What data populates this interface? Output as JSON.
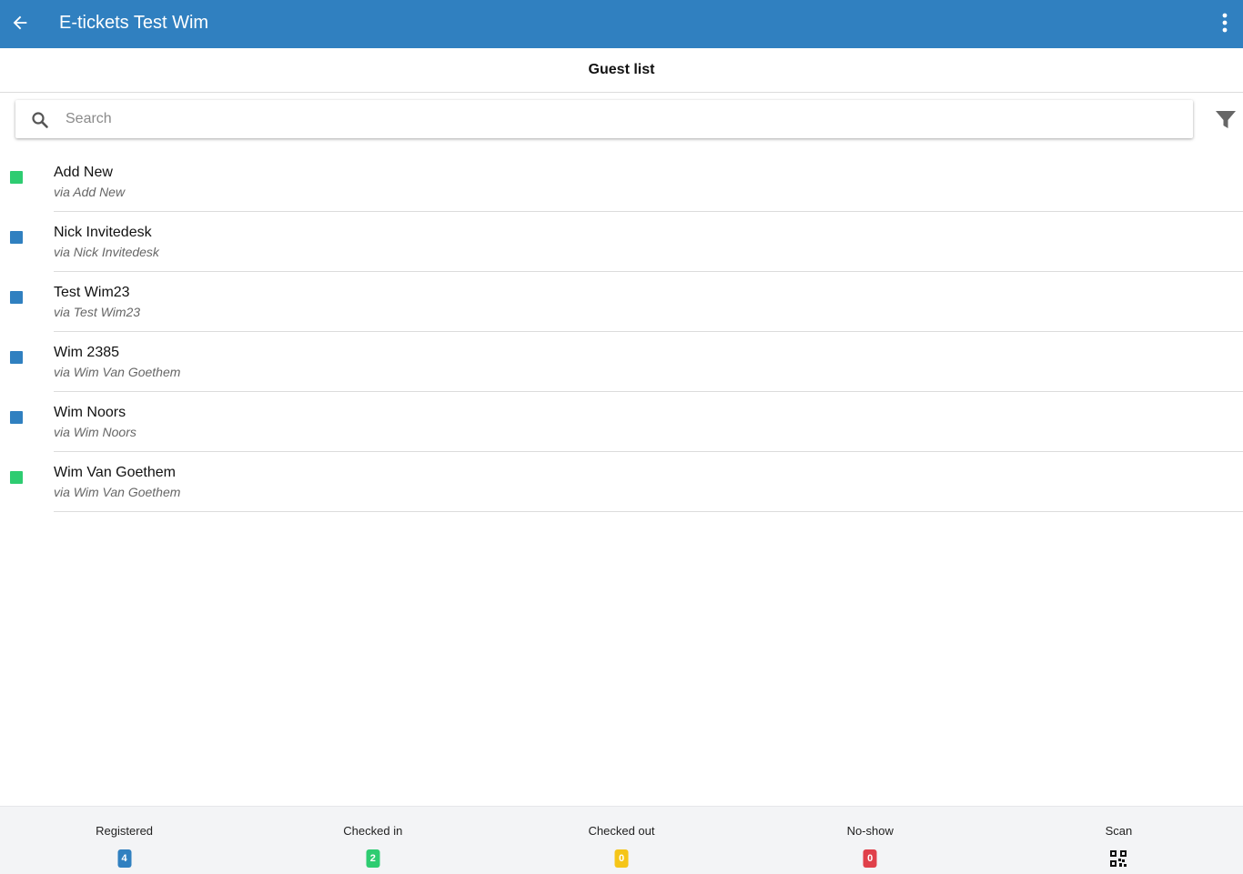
{
  "header": {
    "title": "E-tickets Test Wim",
    "back_icon": "arrow-left-icon",
    "menu_icon": "more-vertical-icon"
  },
  "subheader": {
    "title": "Guest list"
  },
  "search": {
    "placeholder": "Search",
    "value": "",
    "icon": "search-icon",
    "filter_icon": "filter-icon"
  },
  "guests": [
    {
      "name": "Add New",
      "via": "via Add New",
      "status_color": "#2ecc71"
    },
    {
      "name": "Nick Invitedesk",
      "via": "via Nick Invitedesk",
      "status_color": "#3080c0"
    },
    {
      "name": "Test Wim23",
      "via": "via Test Wim23",
      "status_color": "#3080c0"
    },
    {
      "name": "Wim 2385",
      "via": "via Wim Van Goethem",
      "status_color": "#3080c0"
    },
    {
      "name": "Wim Noors",
      "via": "via Wim Noors",
      "status_color": "#3080c0"
    },
    {
      "name": "Wim Van Goethem",
      "via": "via Wim Van Goethem",
      "status_color": "#2ecc71"
    }
  ],
  "tabs": [
    {
      "label": "Registered",
      "count": "4",
      "color": "#3080c0"
    },
    {
      "label": "Checked in",
      "count": "2",
      "color": "#2ecc71"
    },
    {
      "label": "Checked out",
      "count": "0",
      "color": "#f5c518"
    },
    {
      "label": "No-show",
      "count": "0",
      "color": "#e0404a"
    },
    {
      "label": "Scan",
      "icon": "qr-code-icon"
    }
  ],
  "colors": {
    "primary": "#3080c0",
    "green": "#2ecc71",
    "yellow": "#f5c518",
    "red": "#e0404a"
  }
}
